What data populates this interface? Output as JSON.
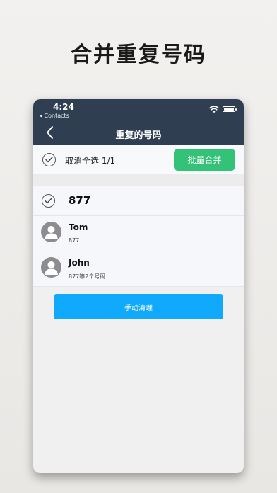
{
  "headline": "合并重复号码",
  "status": {
    "time": "4:24",
    "back_app": "◂ Contacts"
  },
  "nav": {
    "title": "重复的号码"
  },
  "action_bar": {
    "select_label": "取消全选 1/1",
    "merge_label": "批量合并"
  },
  "group": {
    "number": "877",
    "contacts": [
      {
        "name": "Tom",
        "detail": "877"
      },
      {
        "name": "John",
        "detail": "877等2个号码"
      }
    ]
  },
  "manual_clean_label": "手动清理",
  "colors": {
    "nav_bar": "#2f3e51",
    "merge_button": "#33c277",
    "manual_button": "#10a9fb"
  },
  "icons": [
    "back-chevron-icon",
    "wifi-icon",
    "battery-icon",
    "check-icon",
    "person-avatar-icon"
  ]
}
